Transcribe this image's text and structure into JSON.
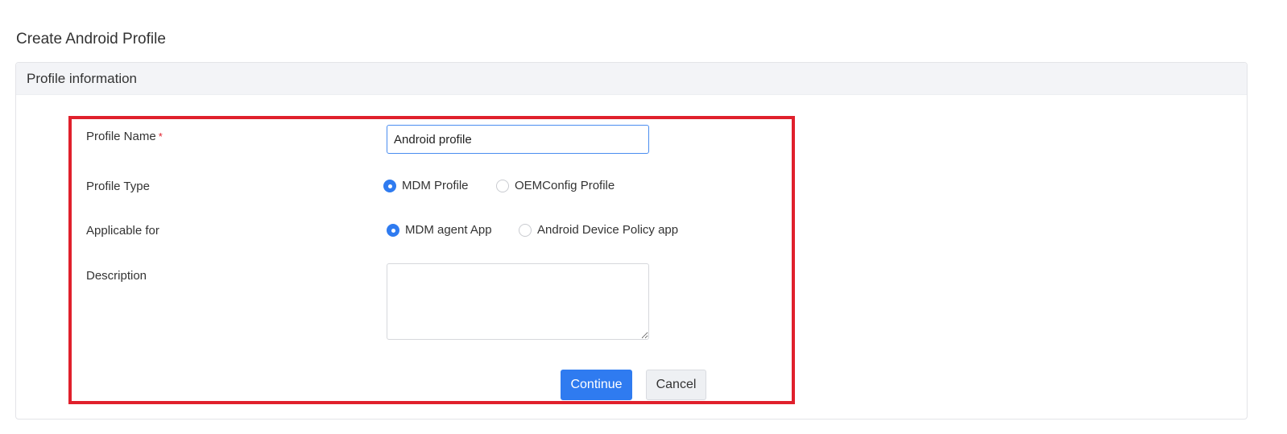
{
  "page": {
    "title": "Create Android Profile"
  },
  "panel": {
    "header": "Profile information"
  },
  "form": {
    "profile_name": {
      "label": "Profile Name",
      "required_mark": "*",
      "value": "Android profile"
    },
    "profile_type": {
      "label": "Profile Type",
      "options": [
        {
          "label": "MDM Profile",
          "selected": true
        },
        {
          "label": "OEMConfig Profile",
          "selected": false
        }
      ]
    },
    "applicable_for": {
      "label": "Applicable for",
      "options": [
        {
          "label": "MDM agent App",
          "selected": true
        },
        {
          "label": "Android Device Policy app",
          "selected": false
        }
      ]
    },
    "description": {
      "label": "Description",
      "value": ""
    }
  },
  "actions": {
    "continue_label": "Continue",
    "cancel_label": "Cancel"
  },
  "colors": {
    "primary": "#2f7bf0",
    "highlight_border": "#e0202c",
    "header_bg": "#f3f4f7"
  }
}
